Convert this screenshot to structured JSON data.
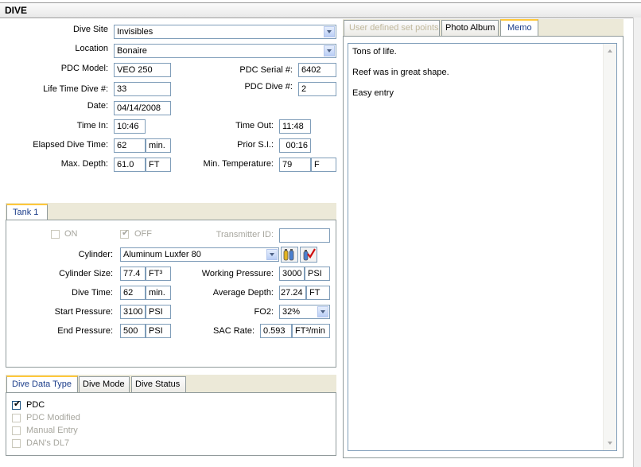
{
  "window": {
    "title": "DIVE"
  },
  "dive": {
    "dive_site_label": "Dive Site",
    "dive_site_value": "Invisibles",
    "location_label": "Location",
    "location_value": "Bonaire",
    "pdc_model_label": "PDC Model:",
    "pdc_model_value": "VEO 250",
    "pdc_serial_label": "PDC Serial #:",
    "pdc_serial_value": "6402",
    "lifetime_dive_label": "Life Time Dive #:",
    "lifetime_dive_value": "33",
    "pdc_dive_label": "PDC Dive #:",
    "pdc_dive_value": "2",
    "date_label": "Date:",
    "date_value": "04/14/2008",
    "time_in_label": "Time In:",
    "time_in_value": "10:46",
    "time_out_label": "Time Out:",
    "time_out_value": "11:48",
    "elapsed_label": "Elapsed Dive Time:",
    "elapsed_value": "62",
    "elapsed_unit": "min.",
    "prior_si_label": "Prior S.I.:",
    "prior_si_value": "00:16",
    "max_depth_label": "Max. Depth:",
    "max_depth_value": "61.0",
    "max_depth_unit": "FT",
    "min_temp_label": "Min. Temperature:",
    "min_temp_value": "79",
    "min_temp_unit": "F"
  },
  "tank": {
    "tab_label": "Tank 1",
    "on_label": "ON",
    "off_label": "OFF",
    "transmitter_label": "Transmitter ID:",
    "transmitter_value": "",
    "cylinder_label": "Cylinder:",
    "cylinder_value": "Aluminum Luxfer 80",
    "cylinder_size_label": "Cylinder Size:",
    "cylinder_size_value": "77.4",
    "cylinder_size_unit": "FT³",
    "working_pressure_label": "Working Pressure:",
    "working_pressure_value": "3000",
    "working_pressure_unit": "PSI",
    "dive_time_label": "Dive Time:",
    "dive_time_value": "62",
    "dive_time_unit": "min.",
    "avg_depth_label": "Average Depth:",
    "avg_depth_value": "27.24",
    "avg_depth_unit": "FT",
    "start_pressure_label": "Start Pressure:",
    "start_pressure_value": "3100",
    "start_pressure_unit": "PSI",
    "fo2_label": "FO2:",
    "fo2_value": "32%",
    "end_pressure_label": "End Pressure:",
    "end_pressure_value": "500",
    "end_pressure_unit": "PSI",
    "sac_label": "SAC Rate:",
    "sac_value": "0.593",
    "sac_unit": "FT³/min"
  },
  "data_type": {
    "tabs": [
      "Dive Data Type",
      "Dive Mode",
      "Dive Status"
    ],
    "options": [
      "PDC",
      "PDC Modified",
      "Manual Entry",
      "DAN's DL7"
    ]
  },
  "right": {
    "tabs": [
      "User defined set points",
      "Photo Album",
      "Memo"
    ],
    "memo_lines": [
      "Tons of life.",
      "Reef was in great shape.",
      "Easy entry"
    ]
  }
}
